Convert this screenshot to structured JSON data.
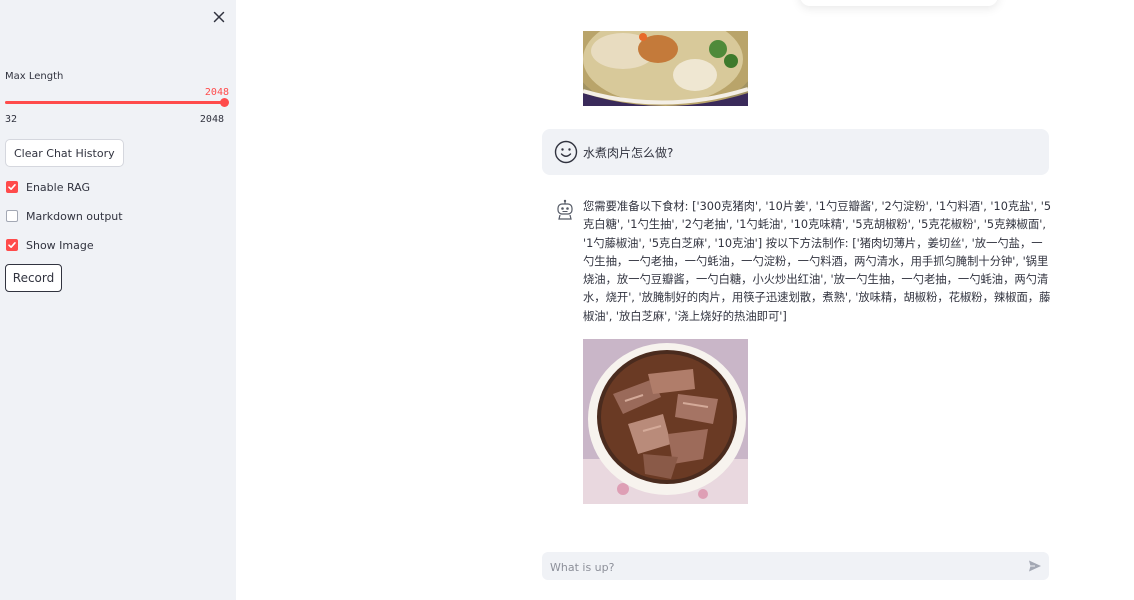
{
  "sidebar": {
    "max_length": {
      "label": "Max Length",
      "value": 2048,
      "value_text": "2048",
      "min": 32,
      "min_text": "32",
      "max": 2048,
      "max_text": "2048"
    },
    "clear_button_label": "Clear Chat History",
    "checkboxes": [
      {
        "label": "Enable RAG",
        "checked": true
      },
      {
        "label": "Markdown output",
        "checked": false
      },
      {
        "label": "Show Image",
        "checked": true
      }
    ],
    "record_button_label": "Record"
  },
  "chat": {
    "user_message": "水煮肉片怎么做?",
    "assistant_message": "您需要准备以下食材: ['300克猪肉', '10片姜', '1勺豆瓣酱', '2勺淀粉', '1勺料酒', '10克盐', '5克白糖', '1勺生抽', '2勺老抽', '1勺蚝油', '10克味精', '5克胡椒粉', '5克花椒粉', '5克辣椒面', '1勺藤椒油', '5克白芝麻', '10克油'] 按以下方法制作: ['猪肉切薄片，姜切丝', '放一勺盐，一勺生抽，一勺老抽，一勺蚝油，一勺淀粉，一勺料酒，两勺清水，用手抓匀腌制十分钟', '锅里烧油，放一勺豆瓣酱，一勺白糖，小火炒出红油', '放一勺生抽，一勺老抽，一勺蚝油，两勺清水，烧开', '放腌制好的肉片，用筷子迅速划散，煮熟', '放味精，胡椒粉，花椒粉，辣椒面，藤椒油', '放白芝麻', '浇上烧好的热油即可']",
    "input_placeholder": "What is up?"
  },
  "icons": {
    "close": "close-icon",
    "check": "check-icon",
    "user_avatar": "smiley-face-icon",
    "assistant_avatar": "robot-icon",
    "send": "send-icon"
  },
  "colors": {
    "accent": "#ff4b4b",
    "sidebar_bg": "#f0f2f6",
    "text": "#31333f"
  }
}
